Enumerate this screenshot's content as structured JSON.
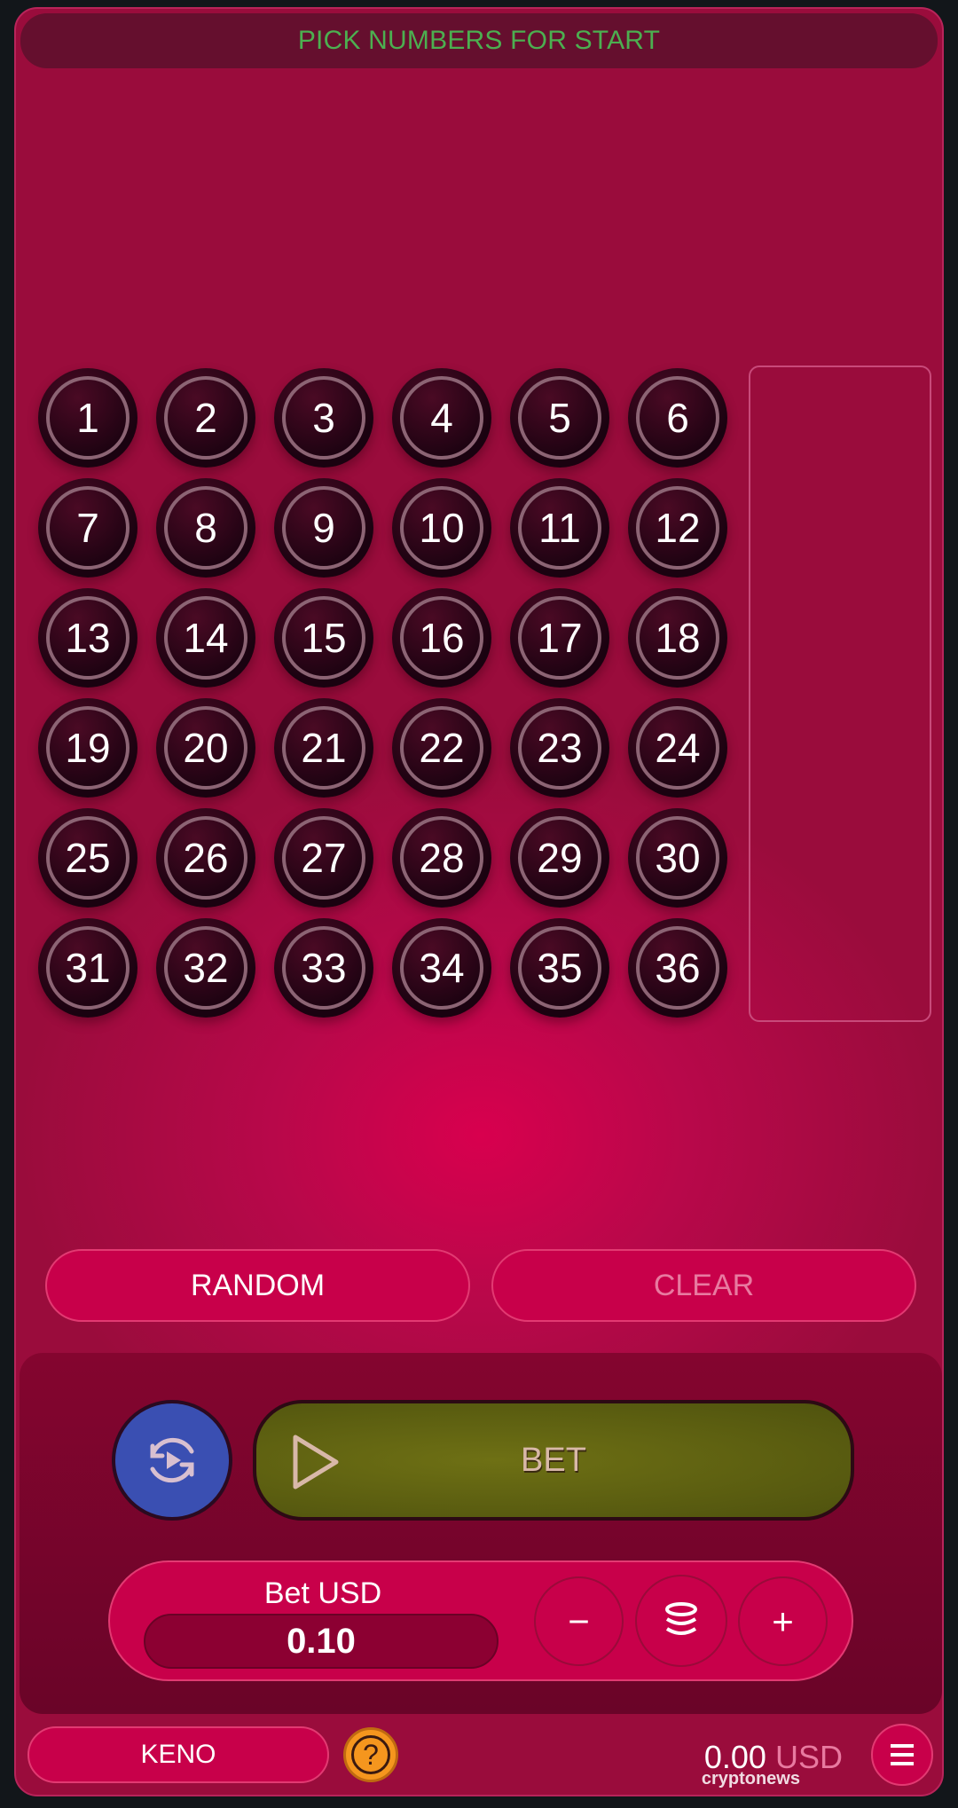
{
  "header": {
    "title": "PICK NUMBERS FOR START"
  },
  "numbers": [
    "1",
    "2",
    "3",
    "4",
    "5",
    "6",
    "7",
    "8",
    "9",
    "10",
    "11",
    "12",
    "13",
    "14",
    "15",
    "16",
    "17",
    "18",
    "19",
    "20",
    "21",
    "22",
    "23",
    "24",
    "25",
    "26",
    "27",
    "28",
    "29",
    "30",
    "31",
    "32",
    "33",
    "34",
    "35",
    "36"
  ],
  "actions": {
    "random": "RANDOM",
    "clear": "CLEAR"
  },
  "controls": {
    "bet_label": "BET",
    "bet_amount_label": "Bet USD",
    "bet_amount": "0.10",
    "minus": "−",
    "plus": "+"
  },
  "footer": {
    "game_name": "KENO",
    "help": "?",
    "balance": "0.00",
    "currency": "USD"
  },
  "watermark": "cryptonews",
  "colors": {
    "background": "#9a0c3c",
    "accent": "#c8004a",
    "title": "#4caf50",
    "bet_button": "#6b6e12",
    "autoplay": "#3a4fb2",
    "help": "#f5961e"
  },
  "icons": {
    "autoplay": "autoplay-refresh-icon",
    "bet": "play-icon",
    "coins": "coins-stack-icon",
    "menu": "hamburger-menu-icon",
    "help": "question-icon"
  }
}
